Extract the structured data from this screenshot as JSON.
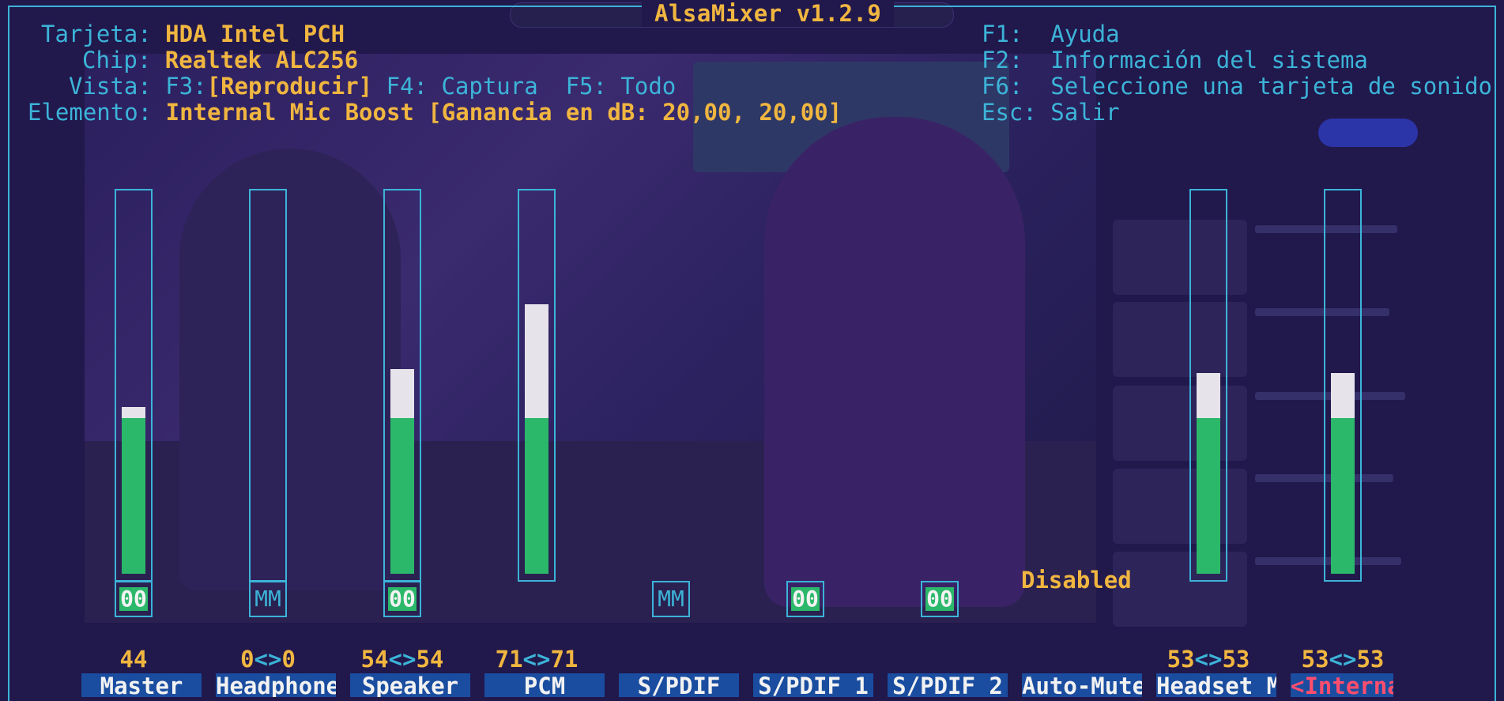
{
  "app": {
    "title": "AlsaMixer v1.2.9"
  },
  "info": {
    "card_label": "Tarjeta:",
    "card_value": "HDA Intel PCH",
    "chip_label": "Chip:",
    "chip_value": "Realtek ALC256",
    "view_label": "Vista:",
    "view_f3": "F3:",
    "view_play": "[Reproducir]",
    "view_f4": "F4: Captura",
    "view_f5": "F5: Todo",
    "item_label": "Elemento:",
    "item_value": "Internal Mic Boost [Ganancia en dB: 20,00, 20,00]"
  },
  "help": [
    "F1:  Ayuda",
    "F2:  Información del sistema",
    "F6:  Seleccione una tarjeta de sonido",
    "Esc: Salir"
  ],
  "channels": [
    {
      "name": "Master",
      "level": 0.44,
      "peak": 0.44,
      "mute": "00",
      "muted": false,
      "volume_left": "44",
      "volume_right": "",
      "has_bar": true
    },
    {
      "name": "Headphone",
      "level": 0.0,
      "peak": 0.0,
      "mute": "MM",
      "muted": true,
      "volume_left": "0",
      "volume_right": "0",
      "has_bar": true
    },
    {
      "name": "Speaker",
      "level": 0.54,
      "peak": 0.54,
      "mute": "00",
      "muted": false,
      "volume_left": "54",
      "volume_right": "54",
      "has_bar": true
    },
    {
      "name": "PCM",
      "level": 0.71,
      "peak": 0.71,
      "mute": "",
      "muted": false,
      "volume_left": "71",
      "volume_right": "71",
      "has_bar": true
    },
    {
      "name": "S/PDIF",
      "mute": "MM",
      "muted": true,
      "has_bar": false
    },
    {
      "name": "S/PDIF 1",
      "mute": "00",
      "muted": false,
      "has_bar": false
    },
    {
      "name": "S/PDIF 2",
      "mute": "00",
      "muted": false,
      "has_bar": false
    },
    {
      "name": "Auto-Mute",
      "status": "Disabled",
      "has_bar": false
    },
    {
      "name": "Headset M",
      "level": 0.53,
      "peak": 0.53,
      "mute": "",
      "volume_left": "53",
      "volume_right": "53",
      "has_bar": true
    },
    {
      "name": "<Internal >",
      "level": 0.53,
      "peak": 0.53,
      "mute": "",
      "volume_left": "53",
      "volume_right": "53",
      "has_bar": true,
      "selected": true
    }
  ],
  "colors": {
    "border": "#3cb4d8",
    "accent": "#f0b640",
    "bar_green": "#2bb86a",
    "bar_white": "#e6e3ea",
    "channel_bg": "#1a4da0",
    "selected_text": "#ff4d6d"
  }
}
